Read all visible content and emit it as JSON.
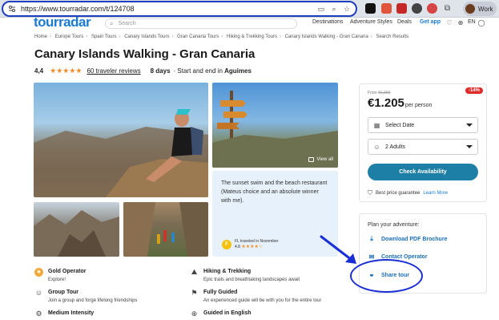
{
  "browser": {
    "url": "https://www.tourradar.com/t/124708",
    "profile_label": "Work",
    "ext_colors": [
      "#111111",
      "#e2553d",
      "#c62828",
      "#444444",
      "#d64545",
      "#555555"
    ]
  },
  "header": {
    "logo": "tourradar",
    "search_placeholder": "Search",
    "nav": [
      "Destinations",
      "Adventure Styles",
      "Deals",
      "Get app"
    ],
    "lang": "EN"
  },
  "breadcrumb": [
    "Home",
    "Europe Tours",
    "Spain Tours",
    "Canary Islands Tours",
    "Gran Canaria Tours",
    "Hiking & Trekking Tours",
    "Canary Islands Walking - Gran Canaria",
    "Search Results"
  ],
  "tour": {
    "title": "Canary Islands Walking - Gran Canaria",
    "rating": "4,4",
    "stars": 4.5,
    "reviews": "60 traveler reviews",
    "duration": "8 days",
    "start_end_prefix": "Start and end in",
    "start_end_city": "Aguimes"
  },
  "gallery": {
    "view_all": "View all"
  },
  "review": {
    "text": "The sunset swim and the beach restaurant (Mateus choice and an absolute winner with me).",
    "badge": "F",
    "reviewer": "FL traveled in November",
    "score": "4.8"
  },
  "features": [
    {
      "title": "Gold Operator",
      "sub": "Explore!",
      "icon": "gold-medal-icon"
    },
    {
      "title": "Hiking & Trekking",
      "sub": "Epic trails and breathtaking landscapes await",
      "icon": "hiking-icon"
    },
    {
      "title": "Group Tour",
      "sub": "Join a group and forge lifelong friendships",
      "icon": "group-icon"
    },
    {
      "title": "Fully Guided",
      "sub": "An experienced guide will be with you for the entire tour",
      "icon": "guide-icon"
    },
    {
      "title": "Medium Intensity",
      "sub": "",
      "icon": "intensity-icon"
    },
    {
      "title": "Guided in English",
      "sub": "",
      "icon": "globe-icon"
    }
  ],
  "booking": {
    "discount": "-14%",
    "from_label": "From",
    "old_price": "€1,399",
    "price": "€1.205",
    "per": "per person",
    "date_label": "Select Date",
    "guests_label": "2 Adults",
    "check_label": "Check Availability",
    "guarantee": "Best price guarantee",
    "learn_more": "Learn More"
  },
  "plan": {
    "title": "Plan your adventure:",
    "download": "Download PDF Brochure",
    "contact": "Contact Operator",
    "share": "Share tour"
  },
  "colors": {
    "brand": "#1b7ad1",
    "cta": "#1e7fa6",
    "star": "#f28c28",
    "annotation": "#1a2ed6"
  }
}
